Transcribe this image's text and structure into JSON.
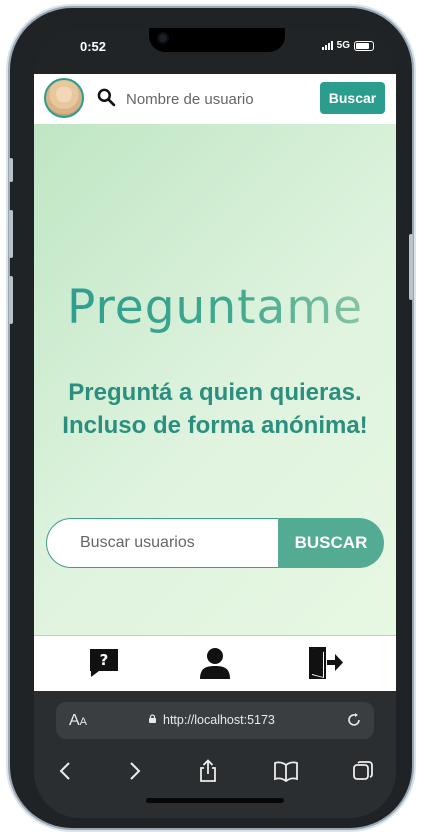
{
  "status": {
    "time": "0:52",
    "network": "5G"
  },
  "topbar": {
    "username_placeholder": "Nombre de usuario",
    "search_button": "Buscar"
  },
  "hero": {
    "logo_text": "Preguntame",
    "tagline_line1": "Preguntá a quien quieras.",
    "tagline_line2": "Incluso de forma anónima!",
    "search_placeholder": "Buscar usuarios",
    "search_button": "BUSCAR"
  },
  "nav": {
    "items": [
      {
        "icon": "question-bubble-icon"
      },
      {
        "icon": "user-icon"
      },
      {
        "icon": "logout-icon"
      }
    ]
  },
  "browser": {
    "url": "http://localhost:5173",
    "text_size_big": "A",
    "text_size_small": "A",
    "actions": [
      "back-icon",
      "forward-icon",
      "share-icon",
      "bookmarks-icon",
      "tabs-icon"
    ]
  },
  "colors": {
    "accent": "#2a9d8f",
    "search_button": "#52ab92",
    "hero_start": "#bfe6c4",
    "hero_end": "#e7f8e2"
  }
}
